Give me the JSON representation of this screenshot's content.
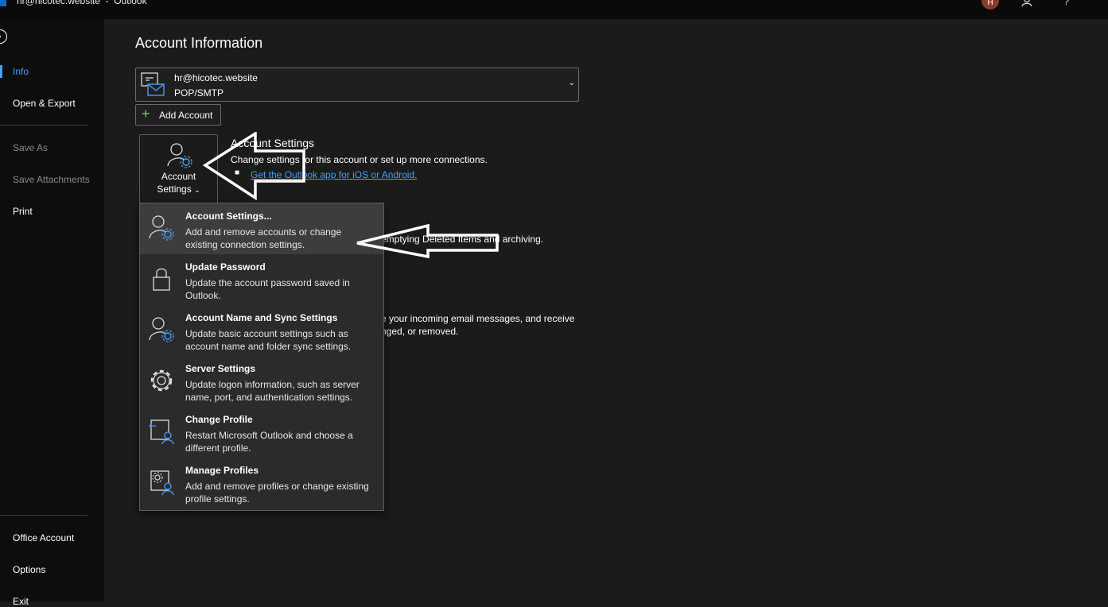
{
  "window": {
    "title": "hr@hicotec.website  -  Outlook",
    "avatar_initial": "H"
  },
  "sidebar": {
    "items": [
      {
        "label": "Info"
      },
      {
        "label": "Open & Export"
      },
      {
        "label": "Save As"
      },
      {
        "label": "Save Attachments"
      },
      {
        "label": "Print"
      },
      {
        "label": "Office Account"
      },
      {
        "label": "Options"
      },
      {
        "label": "Exit"
      }
    ]
  },
  "main": {
    "title": "Account Information",
    "account": {
      "email": "hr@hicotec.website",
      "type": "POP/SMTP"
    },
    "add_account_label": "Add Account",
    "account_settings_button": {
      "line1": "Account",
      "line2": "Settings"
    },
    "account_settings_section": {
      "title": "Account Settings",
      "description": "Change settings for this account or set up more connections.",
      "link": "Get the Outlook app for iOS or Android."
    },
    "background_text": {
      "mailbox_fragment": "emptying Deleted Items and archiving.",
      "rules_fragment_1": "e your incoming email messages, and receive",
      "rules_fragment_2": "nged, or removed."
    }
  },
  "dropdown": {
    "items": [
      {
        "title": "Account Settings...",
        "description": "Add and remove accounts or change existing connection settings.",
        "icon": "account-gear-icon"
      },
      {
        "title": "Update Password",
        "description": "Update the account password saved in Outlook.",
        "icon": "lock-icon"
      },
      {
        "title": "Account Name and Sync Settings",
        "description": "Update basic account settings such as account name and folder sync settings.",
        "icon": "account-gear-icon"
      },
      {
        "title": "Server Settings",
        "description": "Update logon information, such as server name, port, and authentication settings.",
        "icon": "gear-icon"
      },
      {
        "title": "Change Profile",
        "description": "Restart Microsoft Outlook and choose a different profile.",
        "icon": "change-profile-icon"
      },
      {
        "title": "Manage Profiles",
        "description": "Add and remove profiles or change existing profile settings.",
        "icon": "manage-profiles-icon"
      }
    ]
  },
  "colors": {
    "accent": "#479ef5",
    "plus": "#6ccb5f"
  }
}
